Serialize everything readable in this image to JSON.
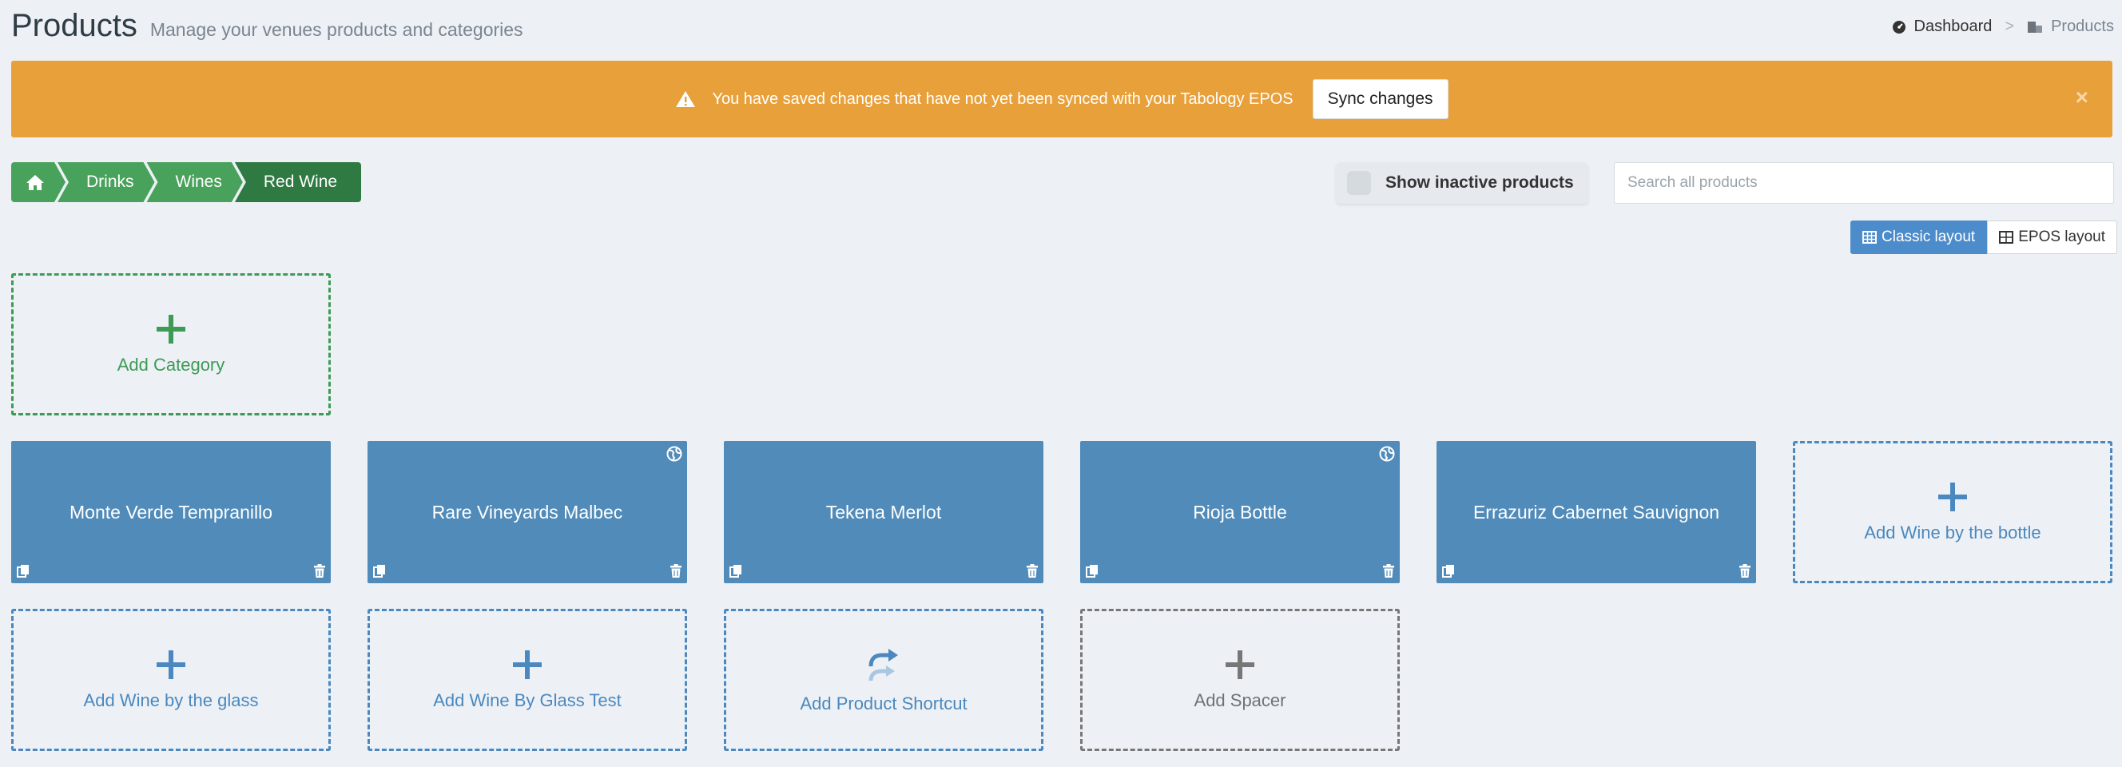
{
  "header": {
    "title": "Products",
    "subtitle": "Manage your venues products and categories"
  },
  "breadcrumb": {
    "dashboard": "Dashboard",
    "current": "Products",
    "separator": ">"
  },
  "alert": {
    "message": "You have saved changes that have not yet been synced with your Tabology EPOS",
    "sync_label": "Sync changes",
    "close": "×"
  },
  "category_path": [
    "Drinks",
    "Wines",
    "Red Wine"
  ],
  "filters": {
    "inactive_label": "Show inactive products",
    "search_placeholder": "Search all products"
  },
  "layout": {
    "classic_label": "Classic layout",
    "epos_label": "EPOS layout"
  },
  "add_category": {
    "label": "Add Category"
  },
  "products": [
    {
      "name": "Monte Verde Tempranillo"
    },
    {
      "name": "Rare Vineyards Malbec"
    },
    {
      "name": "Tekena Merlot"
    },
    {
      "name": "Rioja Bottle"
    },
    {
      "name": "Errazuriz Cabernet Sauvignon"
    }
  ],
  "add_actions": {
    "wine_bottle": "Add Wine by the bottle",
    "wine_glass": "Add Wine by the glass",
    "wine_glass_test": "Add Wine By Glass Test",
    "product_shortcut": "Add Product Shortcut",
    "spacer": "Add Spacer"
  },
  "colors": {
    "background": "#edf1f5",
    "alert": "#e8a03a",
    "green": "#49a25b",
    "green_dark": "#2f7a42",
    "product": "#518bb9",
    "blue": "#4a88bf",
    "active_layout": "#4d8ccb"
  }
}
